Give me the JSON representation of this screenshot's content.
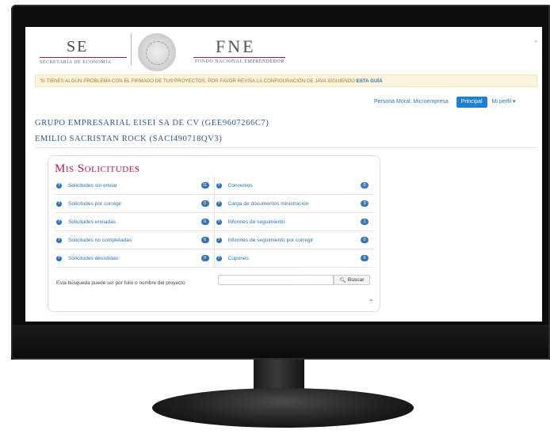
{
  "header": {
    "se_logo": "SE",
    "se_subtitle": "SECRETARÍA DE ECONOMÍA",
    "fne_logo": "FNE",
    "fne_subtitle": "FONDO NACIONAL EMPRENDEDOR",
    "close": "×"
  },
  "alert": {
    "text": "SI TIENES ALGÚN PROBLEMA CON EL FIRMADO DE TUS PROYECTOS, POR FAVOR REVISA LA CONFIGURACIÓN DE JAVA SIGUIENDO ",
    "link": "ESTA GUÍA"
  },
  "userbar": {
    "persona": "Persona Moral: Microempresa",
    "principal": "Principal",
    "perfil": "Mi perfil"
  },
  "company": "GRUPO EMPRESARIAL EISEI SA DE CV (GEE9607266C7)",
  "person": "EMILIO SACRISTAN ROCK (SACI490718QV3)",
  "panel": {
    "title": "Mis Solicitudes",
    "rows": [
      {
        "left": {
          "label": "Solicitudes sin enviar",
          "count": "11"
        },
        "right": {
          "label": "Convenios",
          "count": "0"
        }
      },
      {
        "left": {
          "label": "Solicitudes por corregir",
          "count": "0"
        },
        "right": {
          "label": "Carga de documentos ministración",
          "count": "3"
        }
      },
      {
        "left": {
          "label": "Solicitudes enviadas",
          "count": "0"
        },
        "right": {
          "label": "Informes de seguimiento",
          "count": "1"
        }
      },
      {
        "left": {
          "label": "Solicitudes no completadas",
          "count": "6"
        },
        "right": {
          "label": "Informes de seguimiento por corregir",
          "count": "0"
        }
      },
      {
        "left": {
          "label": "Solicitudes desistidas",
          "count": "0"
        },
        "right": {
          "label": "Cupones",
          "count": "0"
        }
      }
    ],
    "search_hint": "Esta búsqueda puede ser por folio o nombre del proyecto",
    "search_placeholder": "",
    "search_button": "Buscar"
  }
}
